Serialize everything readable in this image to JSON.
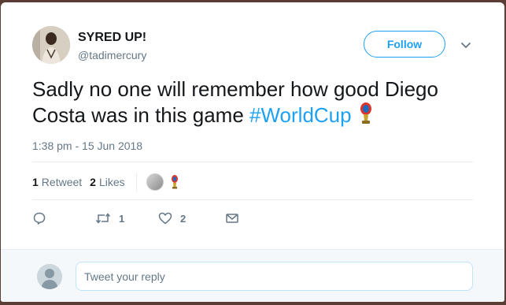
{
  "tweet": {
    "author_name": "SYRED UP!",
    "author_handle": "@tadimercury",
    "follow_label": "Follow",
    "text_main": "Sadly no one will remember how good Diego Costa was in this game ",
    "hashtag": "#WorldCup",
    "timestamp": "1:38 pm - 15 Jun 2018"
  },
  "stats": {
    "retweets_count": "1",
    "retweets_label": "Retweet",
    "likes_count": "2",
    "likes_label": "Likes"
  },
  "actions": {
    "reply_icon": "reply-icon",
    "retweet_icon": "retweet-icon",
    "retweet_count": "1",
    "like_icon": "heart-icon",
    "like_count": "2",
    "dm_icon": "envelope-icon"
  },
  "reply": {
    "placeholder": "Tweet your reply"
  },
  "colors": {
    "accent": "#1da1f2",
    "secondary_text": "#657786",
    "divider": "#e6ecf0"
  }
}
